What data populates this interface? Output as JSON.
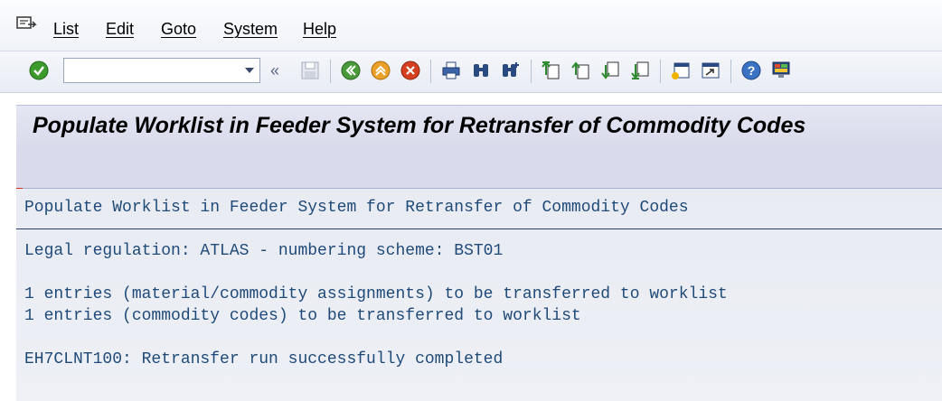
{
  "menu": {
    "items": [
      "List",
      "Edit",
      "Goto",
      "System",
      "Help"
    ]
  },
  "toolbar": {
    "command_field_value": "",
    "icons": [
      "enter-icon",
      "command-dropdown-icon",
      "collapse-icon",
      "save-icon",
      "back-icon",
      "exit-icon",
      "cancel-icon",
      "print-icon",
      "find-icon",
      "find-next-icon",
      "first-page-icon",
      "previous-page-icon",
      "next-page-icon",
      "last-page-icon",
      "create-session-icon",
      "shortcut-icon",
      "help-icon",
      "layout-menu-icon"
    ]
  },
  "title": "Populate Worklist in Feeder System for Retransfer of Commodity Codes",
  "list": {
    "header": "Populate Worklist in Feeder System for Retransfer of Commodity Codes",
    "lines": [
      "Legal regulation: ATLAS - numbering scheme: BST01",
      "1 entries (material/commodity assignments) to be transferred to worklist",
      "1 entries (commodity codes) to be transferred to worklist",
      "EH7CLNT100: Retransfer run successfully completed"
    ]
  },
  "colors": {
    "list_text": "#1f4a78",
    "title_bar": "#dcdeee",
    "accent_red": "#d6321c"
  }
}
